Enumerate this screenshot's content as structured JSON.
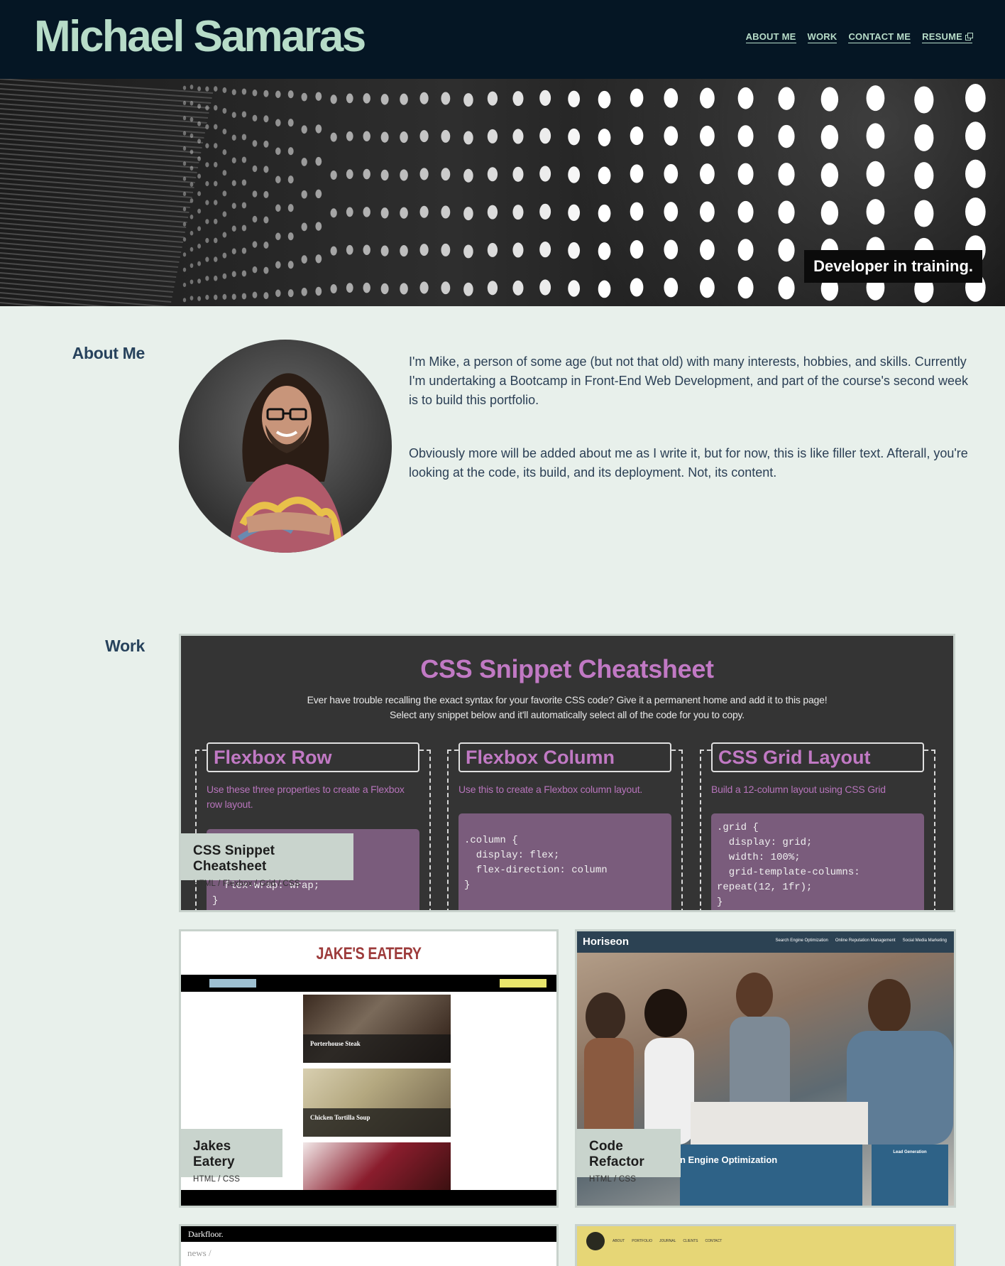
{
  "header": {
    "site_name": "Michael Samaras",
    "nav": [
      "ABOUT ME",
      "WORK",
      "CONTACT ME",
      "RESUME"
    ]
  },
  "hero": {
    "tagline": "Developer in training."
  },
  "about": {
    "heading": "About Me",
    "paragraphs": [
      "I'm Mike, a person of some age (but not that old) with many interests, hobbies, and skills. Currently I'm undertaking a Bootcamp in Front-End Web Development, and part of the course's second week is to build this portfolio.",
      "Obviously more will be added about me as I write it, but for now, this is like filler text. Afterall, you're looking at the code, its build, and its deployment. Not, its content."
    ]
  },
  "work": {
    "heading": "Work",
    "projects": [
      {
        "title": "CSS Snippet Cheatsheet",
        "tech": "HTML / Flexbox / Grid / CSS",
        "preview": {
          "title": "CSS Snippet Cheatsheet",
          "description": "Ever have trouble recalling the exact syntax for your favorite CSS code? Give it a permanent home and add it to this page! Select any snippet below and it'll automatically select all of the code for you to copy.",
          "columns": [
            {
              "heading": "Flexbox Row",
              "desc": "Use these three properties to create a Flexbox row layout.",
              "code": "  flex-wrap: wrap;\n}"
            },
            {
              "heading": "Flexbox Column",
              "desc": "Use this to create a Flexbox column layout.",
              "code": ".column {\n  display: flex;\n  flex-direction: column\n}"
            },
            {
              "heading": "CSS Grid Layout",
              "desc": "Build a 12-column layout using CSS Grid",
              "code": ".grid {\n  display: grid;\n  width: 100%;\n  grid-template-columns:\nrepeat(12, 1fr);\n}"
            }
          ]
        }
      },
      {
        "title": "Jakes Eatery",
        "tech": "HTML / CSS",
        "preview": {
          "title": "JAKE'S EATERY",
          "dishes": [
            "Porterhouse Steak",
            "Chicken Tortilla Soup"
          ]
        }
      },
      {
        "title": "Code Refactor",
        "tech": "HTML / CSS",
        "preview": {
          "brand": "Horiseon",
          "links": [
            "Search Engine Optimization",
            "Online Reputation Management",
            "Social Media Marketing"
          ],
          "panel_heading": "n Engine Optimization",
          "side_heading": "Lead Generation"
        }
      },
      {
        "preview": {
          "logo": "Darkfloor.",
          "section": "news /"
        }
      },
      {
        "preview": {
          "links": [
            "ABOUT",
            "PORTFOLIO",
            "JOURNAL",
            "CLIENTS",
            "CONTACT"
          ]
        }
      }
    ]
  },
  "colors": {
    "header_bg": "#051624",
    "accent": "#b7dcc8",
    "page_bg": "#e8f0eb",
    "heading": "#27425c"
  }
}
